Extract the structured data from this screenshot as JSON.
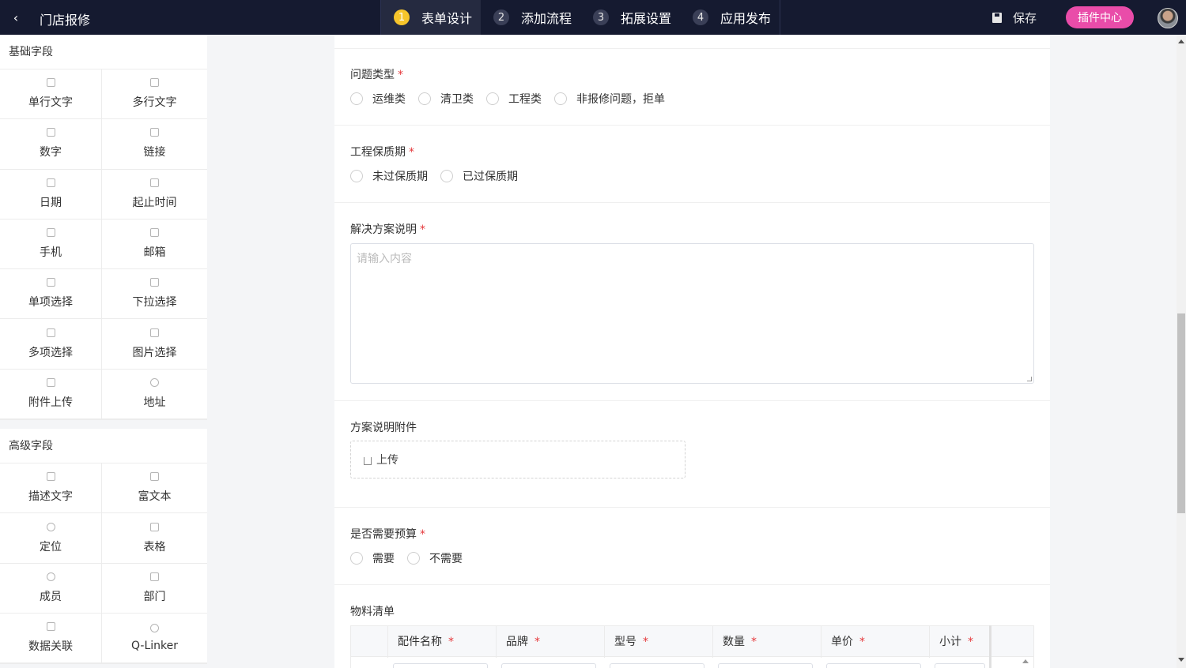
{
  "topbar": {
    "title": "门店报修",
    "steps": [
      {
        "num": "1",
        "label": "表单设计",
        "active": true
      },
      {
        "num": "2",
        "label": "添加流程",
        "active": false
      },
      {
        "num": "3",
        "label": "拓展设置",
        "active": false
      },
      {
        "num": "4",
        "label": "应用发布",
        "active": false
      }
    ],
    "save_label": "保存",
    "plugin_label": "插件中心"
  },
  "sidebar": {
    "basic": {
      "title": "基础字段",
      "items": [
        "单行文字",
        "多行文字",
        "数字",
        "链接",
        "日期",
        "起止时间",
        "手机",
        "邮箱",
        "单项选择",
        "下拉选择",
        "多项选择",
        "图片选择",
        "附件上传",
        "地址"
      ]
    },
    "advanced": {
      "title": "高级字段",
      "items": [
        "描述文字",
        "富文本",
        "定位",
        "表格",
        "成员",
        "部门",
        "数据关联",
        "Q-Linker"
      ]
    }
  },
  "form": {
    "issue_type": {
      "label": "问题类型",
      "required": "*",
      "options": [
        "运维类",
        "清卫类",
        "工程类",
        "非报修问题，拒单"
      ]
    },
    "warranty": {
      "label": "工程保质期",
      "required": "*",
      "options": [
        "未过保质期",
        "已过保质期"
      ]
    },
    "solution": {
      "label": "解决方案说明",
      "required": "*",
      "placeholder": "请输入内容"
    },
    "attachment": {
      "label": "方案说明附件",
      "upload_label": "上传"
    },
    "budget": {
      "label": "是否需要预算",
      "required": "*",
      "options": [
        "需要",
        "不需要"
      ]
    },
    "materials": {
      "label": "物料清单",
      "columns": [
        {
          "label": "配件名称",
          "required": "*"
        },
        {
          "label": "品牌",
          "required": "*"
        },
        {
          "label": "型号",
          "required": "*"
        },
        {
          "label": "数量",
          "required": "*"
        },
        {
          "label": "单价",
          "required": "*"
        },
        {
          "label": "小计",
          "required": "*"
        }
      ]
    }
  }
}
